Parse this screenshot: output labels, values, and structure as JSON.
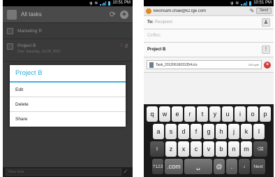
{
  "left": {
    "status": {
      "time": "10:51 PM",
      "icons": [
        "usb-icon",
        "wifi-icon",
        "signal-icon",
        "battery-icon"
      ]
    },
    "titlebar": {
      "title": "All tasks"
    },
    "list": [
      {
        "label": "Marketing R"
      },
      {
        "label": "Project B",
        "sub": "Due: Saturday, Jul 28, 2012"
      }
    ],
    "dialog": {
      "title": "Project B",
      "items": [
        "Edit",
        "Delete",
        "Share"
      ]
    },
    "bottom": {
      "placeholder": "New task"
    }
  },
  "right": {
    "status": {
      "time": "10:51 PM"
    },
    "header": {
      "account": "kwonsam.chae@k2.lge.com",
      "send_label": "Send"
    },
    "to": {
      "label": "To:",
      "placeholder": "Recipient"
    },
    "cc": {
      "placeholder": "Cc/Bcc"
    },
    "subject": {
      "value": "Project B"
    },
    "attachment": {
      "filename": "Task_20120616031354.ics",
      "size": "232 byte"
    },
    "keyboard": {
      "row1": [
        "q",
        "w",
        "e",
        "r",
        "t",
        "y",
        "u",
        "i",
        "o",
        "p"
      ],
      "row2": [
        "a",
        "s",
        "d",
        "f",
        "g",
        "h",
        "j",
        "k",
        "l"
      ],
      "row3": [
        "z",
        "x",
        "c",
        "v",
        "b",
        "n",
        "m"
      ],
      "row4": {
        "sym": "?123",
        "com": ".com",
        "at": "@",
        "dot": ".",
        "next": "Next"
      }
    }
  }
}
